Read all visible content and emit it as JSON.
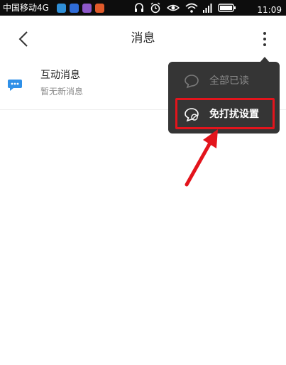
{
  "status_bar": {
    "carrier": "中国移动4G",
    "time": "11:09",
    "app_icons": [
      {
        "name": "app-notification-icon-1",
        "color": "#2f8fd8"
      },
      {
        "name": "app-notification-icon-2",
        "color": "#2f6cd8"
      },
      {
        "name": "app-notification-icon-3",
        "color": "#8d58c9"
      },
      {
        "name": "app-notification-icon-4",
        "color": "#e05a2a"
      }
    ],
    "system_icons": [
      "headphones-icon",
      "alarm-icon",
      "eye-icon",
      "wifi-icon",
      "signal-icon",
      "battery-icon"
    ]
  },
  "header": {
    "title": "消息",
    "back_icon": "chevron-left-icon",
    "more_icon": "more-vertical-icon"
  },
  "messages": [
    {
      "icon": "chat-bubble-icon",
      "icon_color": "#2f90e8",
      "title": "互动消息",
      "subtitle": "暂无新消息"
    }
  ],
  "popup_menu": {
    "items": [
      {
        "label": "全部已读",
        "icon": "read-all-icon",
        "enabled": false
      },
      {
        "label": "免打扰设置",
        "icon": "do-not-disturb-icon",
        "enabled": true,
        "highlighted": true
      }
    ]
  },
  "annotation": {
    "highlight_color": "#e3141c",
    "arrow_color": "#e3141c"
  }
}
